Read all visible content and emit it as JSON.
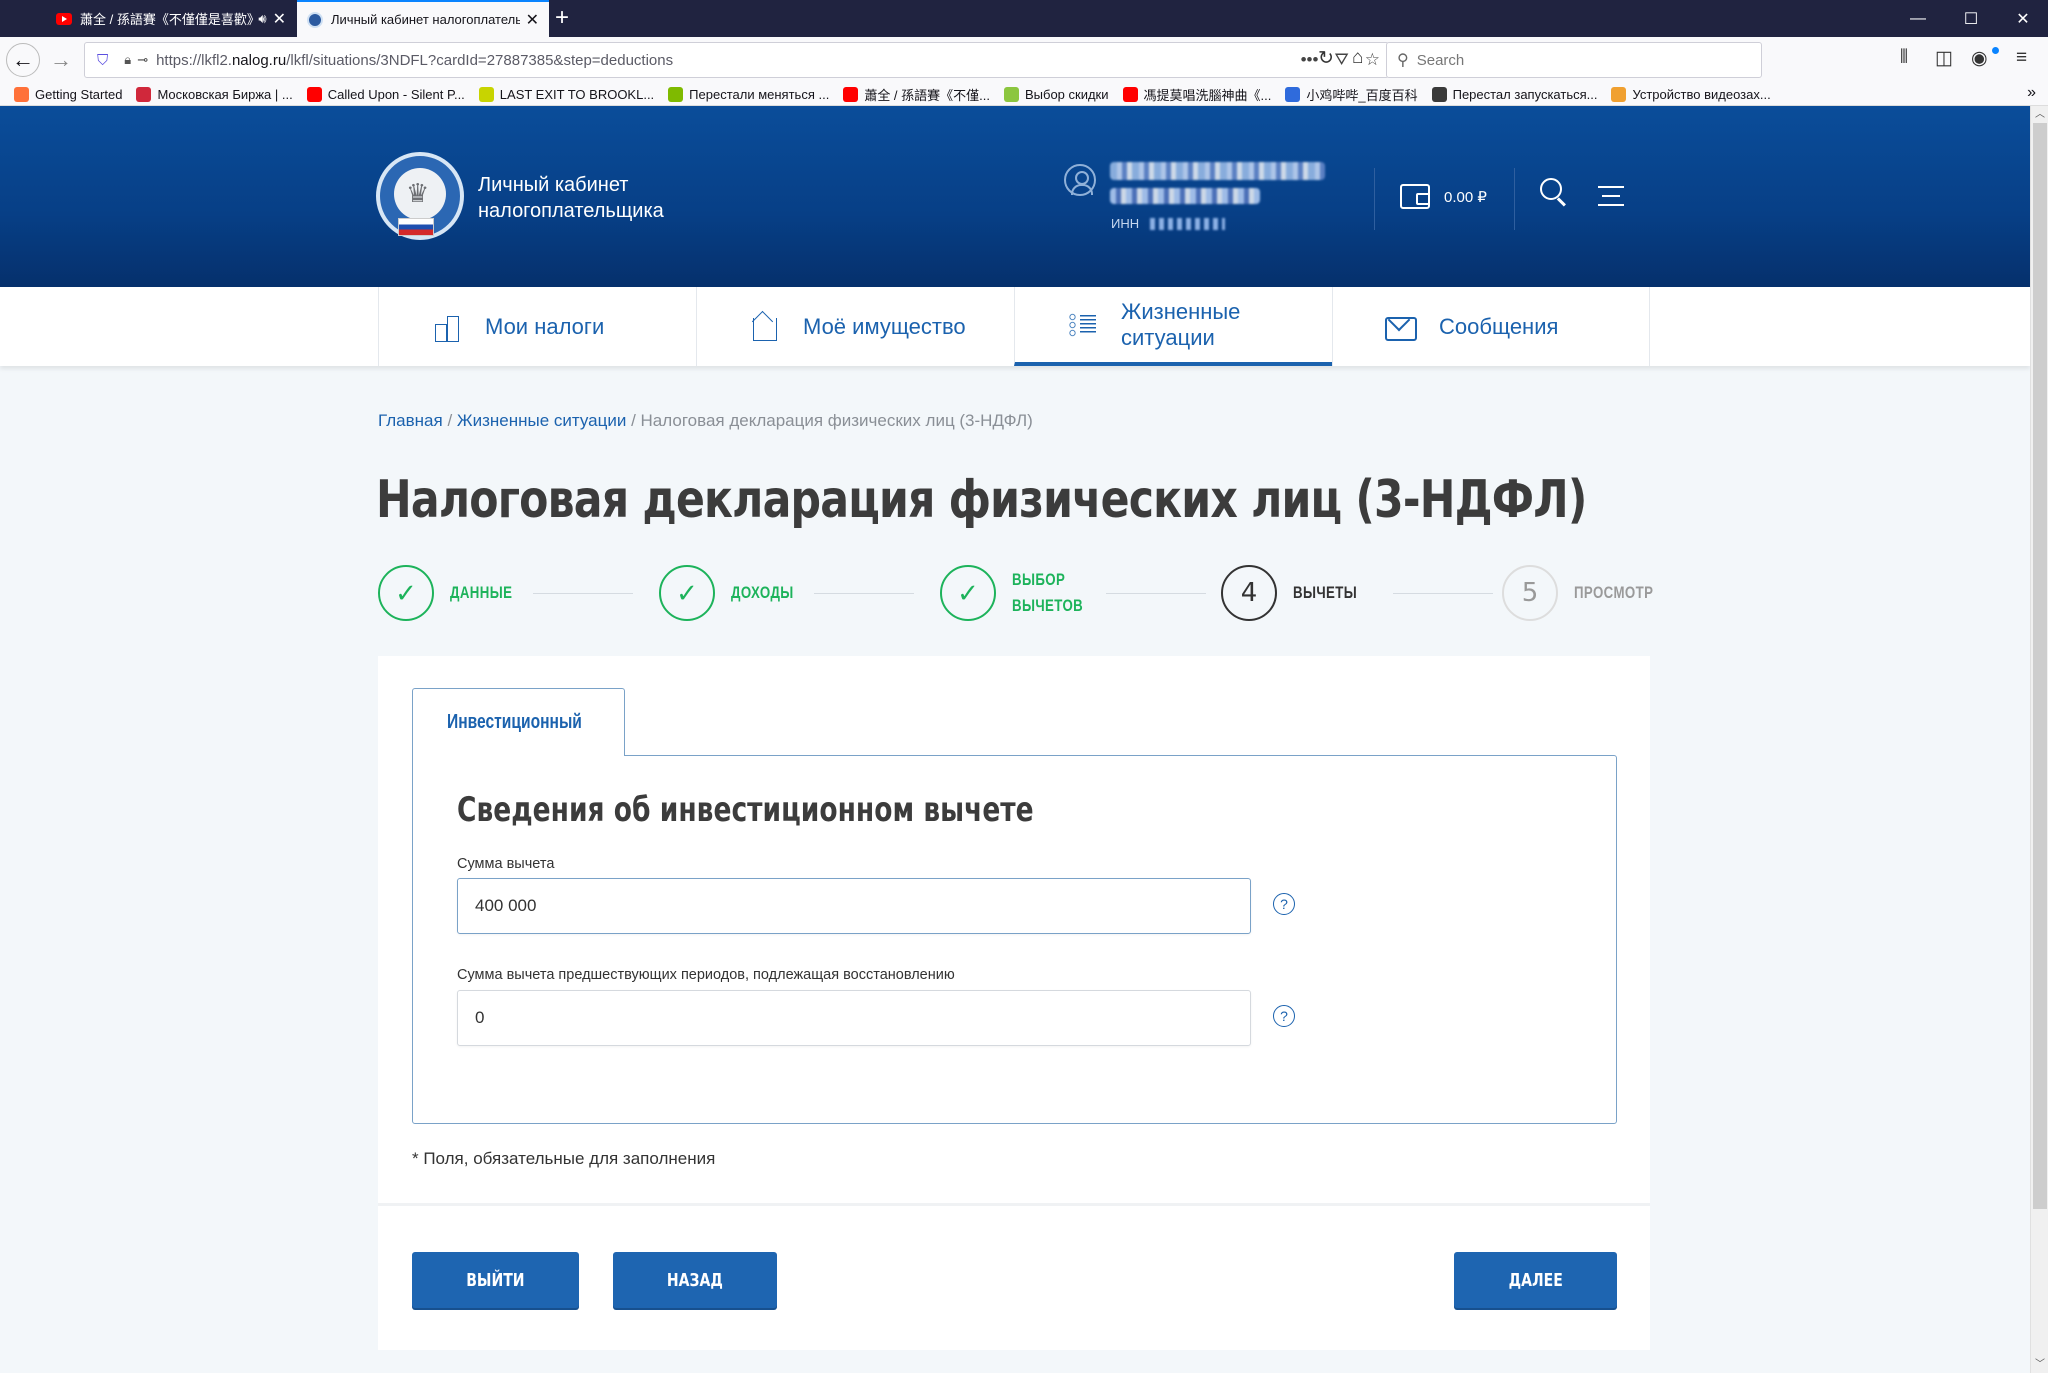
{
  "browser": {
    "tabs": [
      {
        "title": "蕭全 / 孫語賽《不僅僅是喜歡》",
        "icon": "youtube-icon",
        "audio": true,
        "active": false
      },
      {
        "title": "Личный кабинет налогоплательщика",
        "icon": "fns-icon",
        "active": true
      }
    ],
    "new_tab_label": "+",
    "window_controls": {
      "minimize": "—",
      "maximize": "☐",
      "close": "✕"
    },
    "url_host_prefix": "https://lkfl2.",
    "url_host_domain": "nalog.ru",
    "url_path": "/lkfl/situations/3NDFL?cardId=27887385&step=deductions",
    "search_placeholder": "Search",
    "bookmarks": [
      {
        "label": "Getting Started",
        "icon": "firefox-icon",
        "color": "#ff7139"
      },
      {
        "label": "Московская Биржа | ...",
        "icon": "moex-icon",
        "color": "#d0283b"
      },
      {
        "label": "Called Upon - Silent P...",
        "icon": "youtube-icon",
        "color": "#ff0000"
      },
      {
        "label": "LAST EXIT TO BROOKL...",
        "icon": "star-icon",
        "color": "#c8d400"
      },
      {
        "label": "Перестали меняться ...",
        "icon": "microsoft-icon",
        "color": "#7fba00"
      },
      {
        "label": "蕭全 / 孫語賽《不僅...",
        "icon": "youtube-icon",
        "color": "#ff0000"
      },
      {
        "label": "Выбор скидки",
        "icon": "discount-icon",
        "color": "#8cc63f"
      },
      {
        "label": "馮提莫唱洗腦神曲《...",
        "icon": "youtube-icon",
        "color": "#ff0000"
      },
      {
        "label": "小鸡哔哔_百度百科",
        "icon": "baidu-icon",
        "color": "#2f6bdc"
      },
      {
        "label": "Перестал запускаться...",
        "icon": "site-icon",
        "color": "#3a3a3a"
      },
      {
        "label": "Устройство видеозах...",
        "icon": "cat-icon",
        "color": "#f0a030"
      }
    ],
    "bookmarks_more": "»"
  },
  "header": {
    "brand_line1": "Личный кабинет",
    "brand_line2": "налогоплательщика",
    "inn_label": "ИНН",
    "balance": "0.00 ₽"
  },
  "nav": {
    "items": [
      {
        "label": "Мои налоги",
        "icon": "taxes-icon",
        "active": false
      },
      {
        "label": "Моё имущество",
        "icon": "property-icon",
        "active": false
      },
      {
        "label": "Жизненные ситуации",
        "icon": "life-situations-icon",
        "active": true
      },
      {
        "label": "Сообщения",
        "icon": "messages-icon",
        "active": false
      }
    ]
  },
  "breadcrumb": {
    "home": "Главная",
    "sep": " / ",
    "section": "Жизненные ситуации",
    "current": "Налоговая декларация физических лиц (3-НДФЛ)"
  },
  "page_title": "Налоговая декларация физических лиц (3-НДФЛ)",
  "stepper": {
    "steps": [
      {
        "num": "✓",
        "label_1": "ДАННЫЕ",
        "label_2": "",
        "state": "done"
      },
      {
        "num": "✓",
        "label_1": "ДОХОДЫ",
        "label_2": "",
        "state": "done"
      },
      {
        "num": "✓",
        "label_1": "ВЫБОР",
        "label_2": "ВЫЧЕТОВ",
        "state": "done"
      },
      {
        "num": "4",
        "label_1": "ВЫЧЕТЫ",
        "label_2": "",
        "state": "current"
      },
      {
        "num": "5",
        "label_1": "ПРОСМОТР",
        "label_2": "",
        "state": "future"
      }
    ]
  },
  "form": {
    "tab_label": "Инвестиционный",
    "title": "Сведения об инвестиционном вычете",
    "fields": [
      {
        "label": "Сумма вычета",
        "value": "400 000"
      },
      {
        "label": "Сумма вычета предшествующих периодов, подлежащая восстановлению",
        "value": "0"
      }
    ],
    "help_glyph": "?",
    "required_note": "* Поля, обязательные для заполнения"
  },
  "actions": {
    "exit_label": "ВЫЙТИ",
    "back_label": "НАЗАД",
    "next_label": "ДАЛЕЕ"
  },
  "colors": {
    "brand_blue": "#1b62ae",
    "button_blue": "#1e65b1",
    "header_blue": "#0a4d9a",
    "success_green": "#1db35b"
  }
}
